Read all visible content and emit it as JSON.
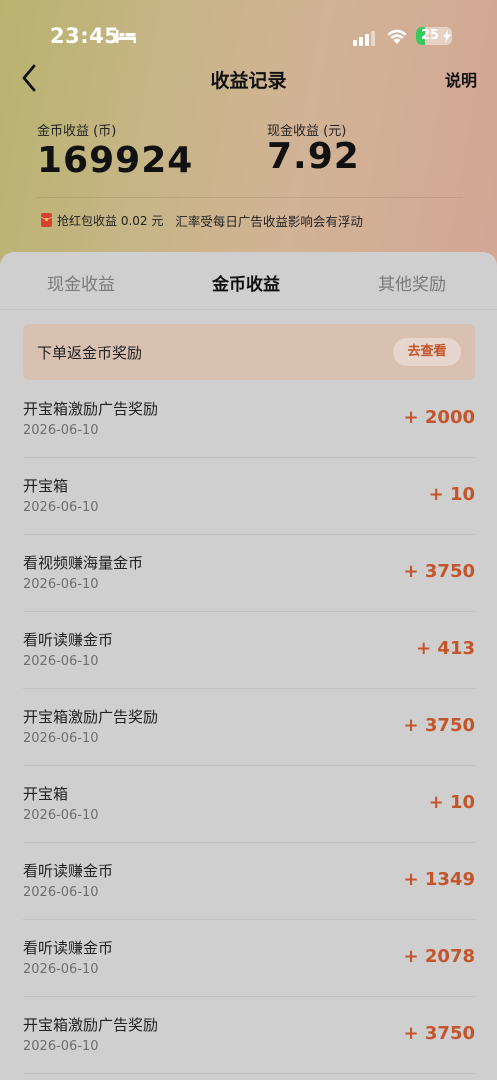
{
  "status_bar": {
    "time": "23:45",
    "battery": "25",
    "battery_level": 0.25,
    "icons": [
      "bed-icon",
      "signal-icon",
      "wifi-icon",
      "battery-icon",
      "charging-bolt-icon"
    ]
  },
  "nav": {
    "back_icon": "chevron-left-icon",
    "title": "收益记录",
    "help_label": "说明"
  },
  "summary": {
    "coin_label": "金币收益 (币)",
    "coin_value": "169924",
    "cash_label": "现金收益 (元)",
    "cash_value": "7.92"
  },
  "notice": {
    "icon": "red-envelope-icon",
    "red_packet": "抢红包收益 0.02 元",
    "rate_note": "汇率受每日广告收益影响会有浮动"
  },
  "tabs": [
    {
      "label": "现金收益",
      "active": false
    },
    {
      "label": "金币收益",
      "active": true
    },
    {
      "label": "其他奖励",
      "active": false
    }
  ],
  "banner": {
    "text": "下单返金币奖励",
    "button": "去查看"
  },
  "records": [
    {
      "title": "开宝箱激励广告奖励",
      "date": "2026-06-10",
      "amount": "+ 2000"
    },
    {
      "title": "开宝箱",
      "date": "2026-06-10",
      "amount": "+ 10"
    },
    {
      "title": "看视频赚海量金币",
      "date": "2026-06-10",
      "amount": "+ 3750"
    },
    {
      "title": "看听读赚金币",
      "date": "2026-06-10",
      "amount": "+ 413"
    },
    {
      "title": "开宝箱激励广告奖励",
      "date": "2026-06-10",
      "amount": "+ 3750"
    },
    {
      "title": "开宝箱",
      "date": "2026-06-10",
      "amount": "+ 10"
    },
    {
      "title": "看听读赚金币",
      "date": "2026-06-10",
      "amount": "+ 1349"
    },
    {
      "title": "看听读赚金币",
      "date": "2026-06-10",
      "amount": "+ 2078"
    },
    {
      "title": "开宝箱激励广告奖励",
      "date": "2026-06-10",
      "amount": "+ 3750"
    }
  ],
  "colors": {
    "accent": "#c4552b",
    "header_gradient_start": "#b7b36e",
    "header_gradient_end": "#d3a695",
    "sheet_bg": "#cfcfcf",
    "banner_bg": "#d9c1b2"
  }
}
